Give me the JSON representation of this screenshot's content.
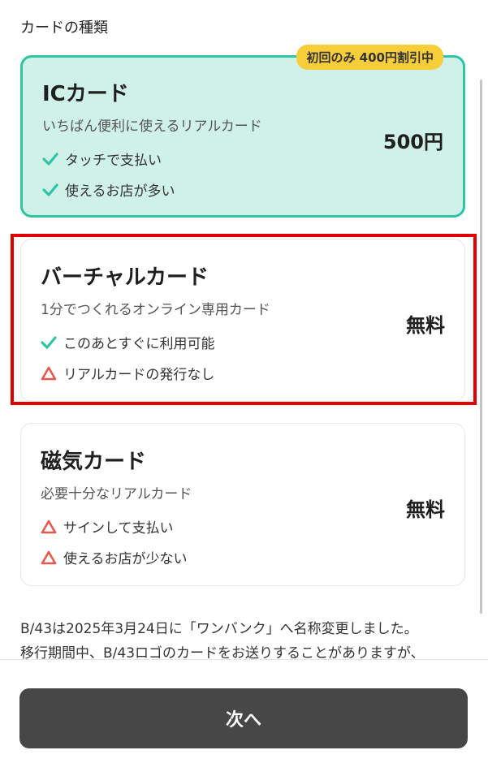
{
  "section_title": "カードの種類",
  "colors": {
    "accent_teal": "#2ec4a4",
    "selected_bg": "#cff1e8",
    "badge_bg": "#f7cd3a",
    "warning_red": "#e8584d",
    "button_bg": "#474747",
    "highlight_border": "#e00000"
  },
  "cards": [
    {
      "title": "ICカード",
      "description": "いちばん便利に使えるリアルカード",
      "price": "500円",
      "badge": "初回のみ 400円割引中",
      "selected": true,
      "features": [
        {
          "icon": "check-icon",
          "text": "タッチで支払い"
        },
        {
          "icon": "check-icon",
          "text": "使えるお店が多い"
        }
      ]
    },
    {
      "title": "バーチャルカード",
      "description": "1分でつくれるオンライン専用カード",
      "price": "無料",
      "selected": false,
      "features": [
        {
          "icon": "check-icon",
          "text": "このあとすぐに利用可能"
        },
        {
          "icon": "warning-triangle-icon",
          "text": "リアルカードの発行なし"
        }
      ]
    },
    {
      "title": "磁気カード",
      "description": "必要十分なリアルカード",
      "price": "無料",
      "selected": false,
      "features": [
        {
          "icon": "warning-triangle-icon",
          "text": "サインして支払い"
        },
        {
          "icon": "warning-triangle-icon",
          "text": "使えるお店が少ない"
        }
      ]
    }
  ],
  "notice": {
    "line1": "B/43は2025年3月24日に「ワンバンク」へ名称変更しました。",
    "line2": "移行期間中、B/43ロゴのカードをお送りすることがありますが、"
  },
  "next_button_label": "次へ"
}
